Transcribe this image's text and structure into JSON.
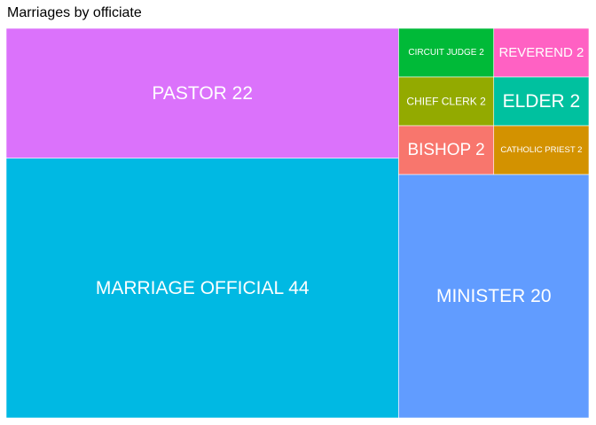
{
  "chart_data": {
    "type": "treemap",
    "title": "Marriages by officiate",
    "items": [
      {
        "label": "MARRIAGE OFFICIAL",
        "value": 44,
        "color": "#00b9e3",
        "text": "MARRIAGE OFFICIAL 44"
      },
      {
        "label": "PASTOR",
        "value": 22,
        "color": "#db72fb",
        "text": "PASTOR 22"
      },
      {
        "label": "MINISTER",
        "value": 20,
        "color": "#619cff",
        "text": "MINISTER 20"
      },
      {
        "label": "BISHOP",
        "value": 2,
        "color": "#f8766d",
        "text": "BISHOP 2"
      },
      {
        "label": "CATHOLIC PRIEST",
        "value": 2,
        "color": "#d39200",
        "text": "CATHOLIC PRIEST 2"
      },
      {
        "label": "CHIEF CLERK",
        "value": 2,
        "color": "#93aa00",
        "text": "CHIEF CLERK 2"
      },
      {
        "label": "ELDER",
        "value": 2,
        "color": "#00c19f",
        "text": "ELDER 2"
      },
      {
        "label": "CIRCUIT JUDGE",
        "value": 2,
        "color": "#00ba38",
        "text": "CIRCUIT JUDGE  2"
      },
      {
        "label": "REVEREND",
        "value": 2,
        "color": "#ff61c3",
        "text": "REVEREND 2"
      }
    ]
  }
}
